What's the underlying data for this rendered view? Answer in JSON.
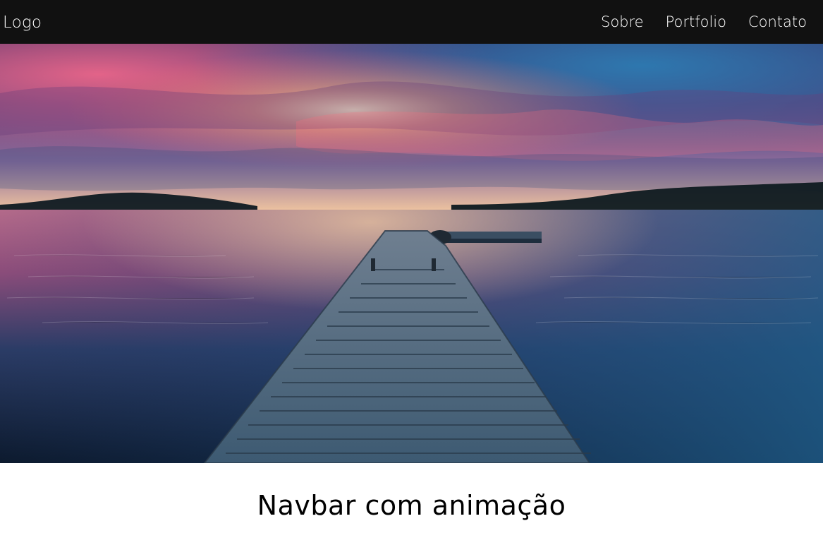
{
  "navbar": {
    "logo": "Logo",
    "links": [
      {
        "label": "Sobre"
      },
      {
        "label": "Portfolio"
      },
      {
        "label": "Contato"
      }
    ]
  },
  "hero": {
    "image": "lake-sunset-dock-photo"
  },
  "main": {
    "title": "Navbar com animação"
  },
  "colors": {
    "navbar_bg": "#111111",
    "nav_text": "#ffffff",
    "page_bg": "#ffffff",
    "title_text": "#000000"
  }
}
